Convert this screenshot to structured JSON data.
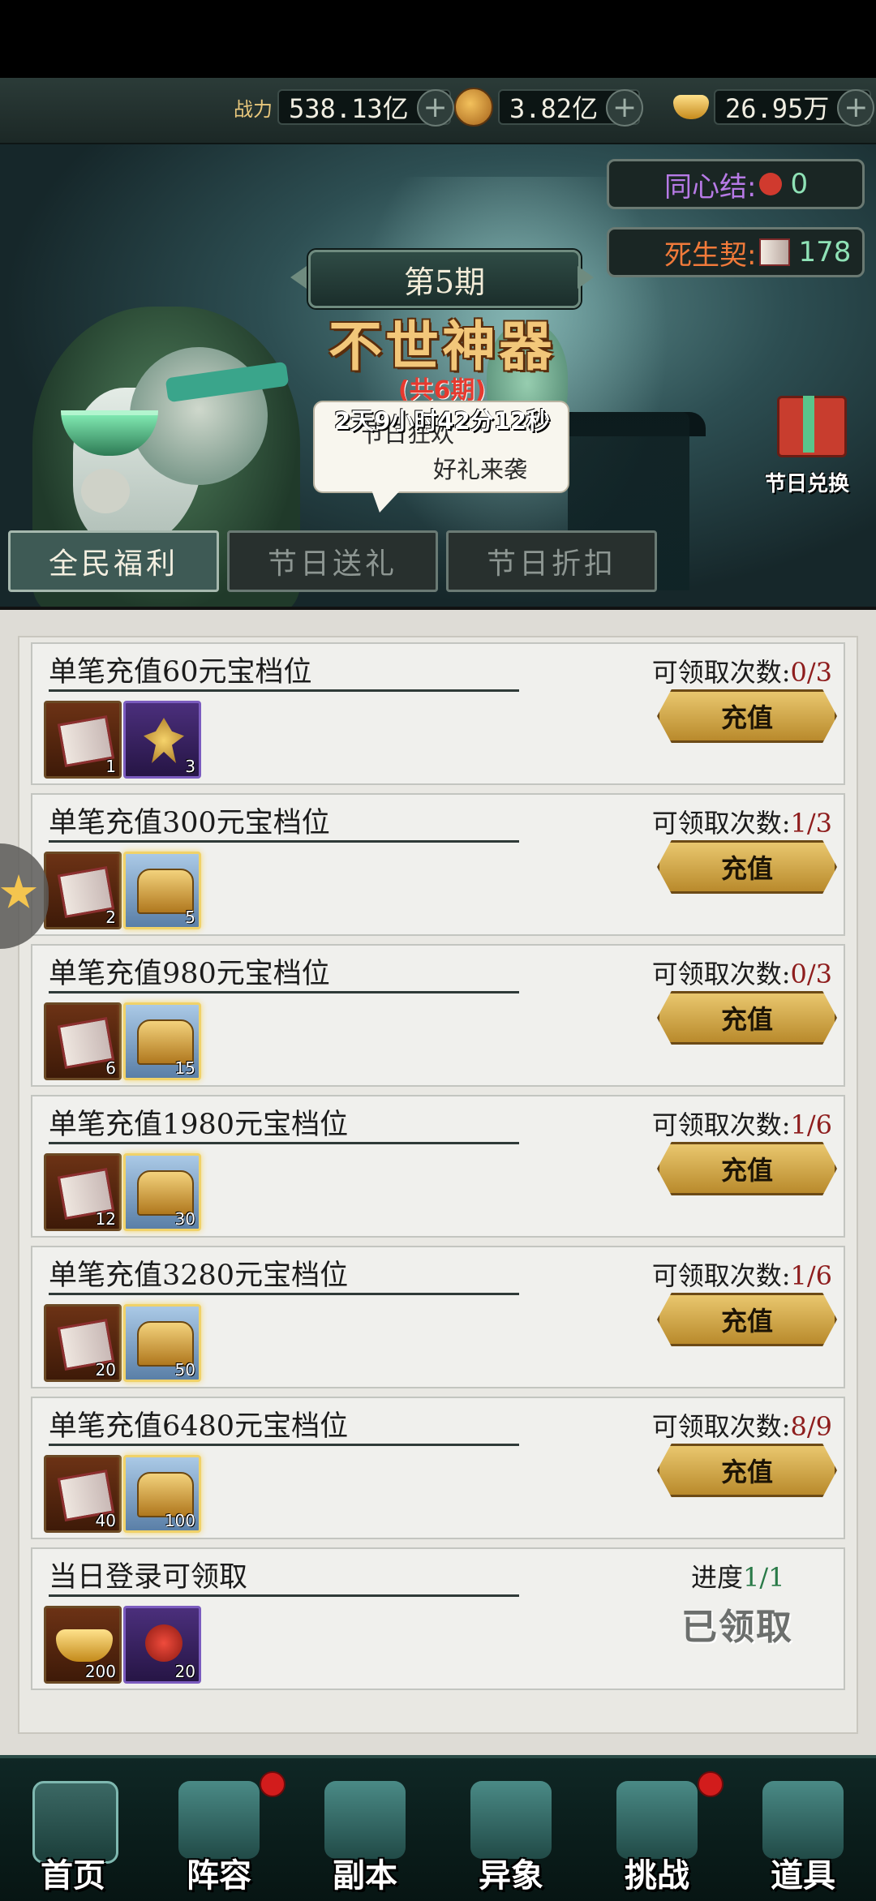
{
  "resources": {
    "power_label": "战力",
    "power_value": "538.13亿",
    "coins_value": "3.82亿",
    "gold_value": "26.95万"
  },
  "banner": {
    "period": "第5期",
    "title": "不世神器",
    "subtitle": "(共6期)",
    "countdown": "2天9小时42分12秒",
    "speech_line1": "节日狂欢",
    "speech_line2": "好礼来袭",
    "tongxinjie_label": "同心结:",
    "tongxinjie_value": "0",
    "sishengqi_label": "死生契:",
    "sishengqi_value": "178",
    "exchange_label": "节日兑换"
  },
  "tabs": [
    {
      "label": "全民福利",
      "active": true
    },
    {
      "label": "节日送礼",
      "active": false
    },
    {
      "label": "节日折扣",
      "active": false
    }
  ],
  "claim_label": "可领取次数:",
  "recharge_label": "充值",
  "rows": [
    {
      "title": "单笔充值60元宝档位",
      "claims": "0/3",
      "rewards": [
        {
          "kind": "book",
          "count": "1"
        },
        {
          "kind": "purple",
          "count": "3"
        }
      ]
    },
    {
      "title": "单笔充值300元宝档位",
      "claims": "1/3",
      "rewards": [
        {
          "kind": "book",
          "count": "2"
        },
        {
          "kind": "chest",
          "count": "5"
        }
      ]
    },
    {
      "title": "单笔充值980元宝档位",
      "claims": "0/3",
      "rewards": [
        {
          "kind": "book",
          "count": "6"
        },
        {
          "kind": "chest",
          "count": "15"
        }
      ]
    },
    {
      "title": "单笔充值1980元宝档位",
      "claims": "1/6",
      "rewards": [
        {
          "kind": "book",
          "count": "12"
        },
        {
          "kind": "chest",
          "count": "30"
        }
      ]
    },
    {
      "title": "单笔充值3280元宝档位",
      "claims": "1/6",
      "rewards": [
        {
          "kind": "book",
          "count": "20"
        },
        {
          "kind": "chest",
          "count": "50"
        }
      ]
    },
    {
      "title": "单笔充值6480元宝档位",
      "claims": "8/9",
      "rewards": [
        {
          "kind": "book",
          "count": "40"
        },
        {
          "kind": "chest",
          "count": "100"
        }
      ]
    }
  ],
  "login_row": {
    "title": "当日登录可领取",
    "progress_label": "进度",
    "progress_value": "1/1",
    "claimed_label": "已领取",
    "rewards": [
      {
        "kind": "gold",
        "count": "200"
      },
      {
        "kind": "knot",
        "count": "20"
      }
    ]
  },
  "nav": [
    {
      "label": "首页",
      "badge": false
    },
    {
      "label": "阵容",
      "badge": true
    },
    {
      "label": "副本",
      "badge": false
    },
    {
      "label": "异象",
      "badge": false
    },
    {
      "label": "挑战",
      "badge": true
    },
    {
      "label": "道具",
      "badge": false
    }
  ],
  "colors": {
    "accent_gold": "#e9c76e",
    "claims_red": "#8e1d1d",
    "progress_green": "#2a7a48",
    "badge_red": "#d21c1c"
  }
}
